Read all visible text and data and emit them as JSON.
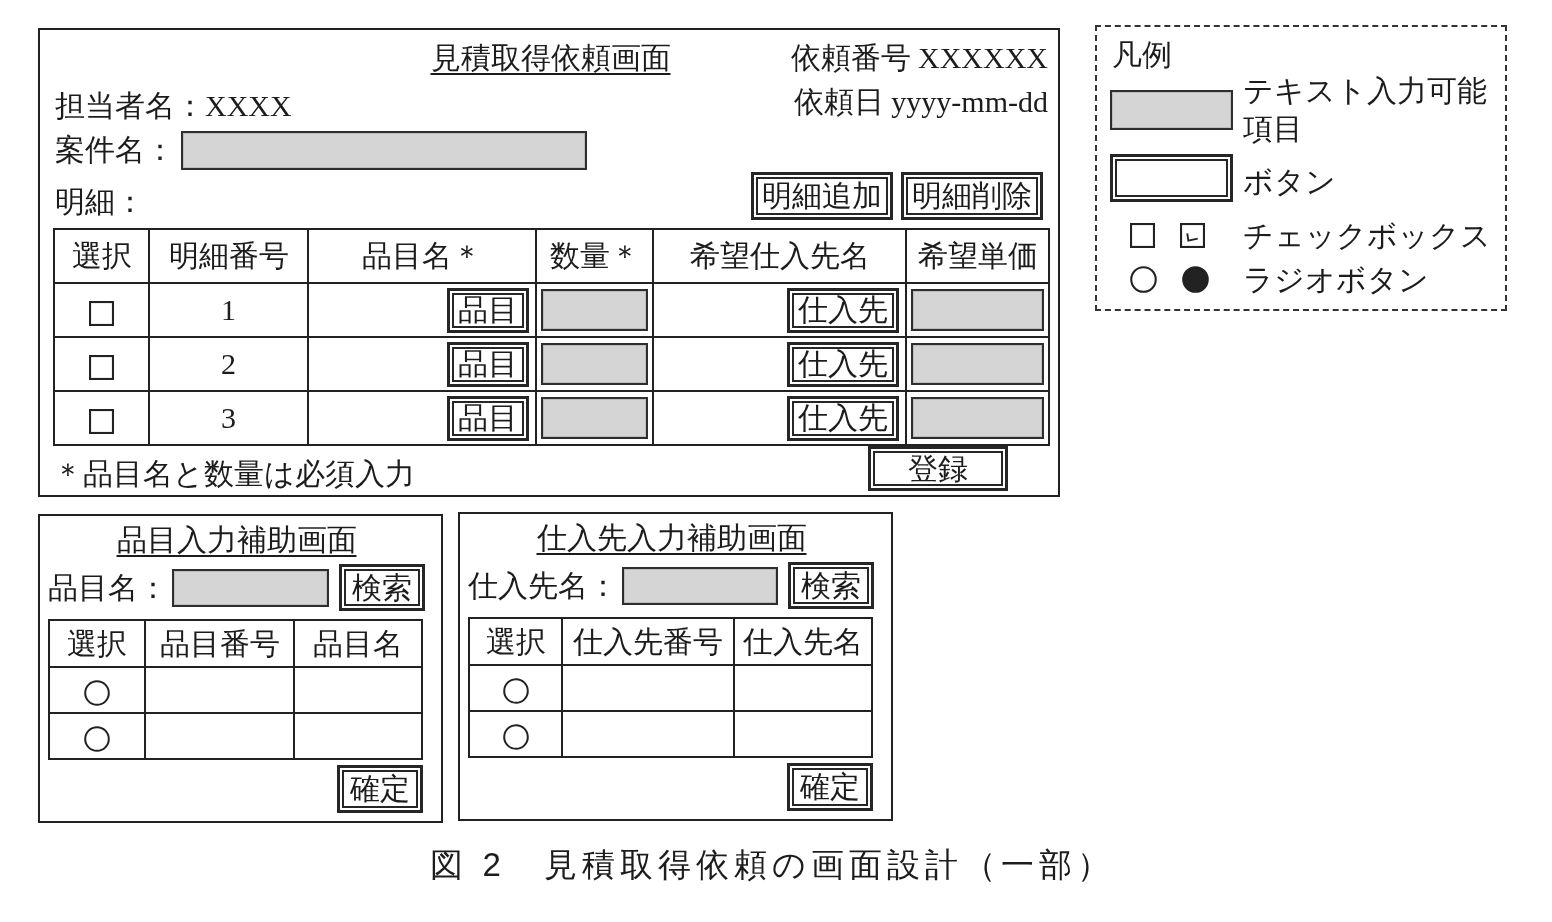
{
  "main_screen": {
    "title": "見積取得依頼画面",
    "request_number": "依頼番号 XXXXXX",
    "request_date": "依頼日 yyyy-mm-dd",
    "person_in_charge": "担当者名：XXXX",
    "case_name_label": "案件名：",
    "details_label": "明細：",
    "buttons": [
      "明細追加",
      "明細削除"
    ],
    "table": {
      "columns": [
        "選択",
        "明細番号",
        "品目名＊",
        "数量＊",
        "希望仕入先名",
        "希望単価"
      ],
      "rows": [
        {
          "cells": [
            {
              "kind": "checkbox",
              "checked": false
            },
            {
              "kind": "text",
              "text": "1"
            },
            {
              "kind": "button",
              "label": "品目"
            },
            {
              "kind": "input"
            },
            {
              "kind": "button",
              "label": "仕入先"
            },
            {
              "kind": "input"
            }
          ]
        },
        {
          "cells": [
            {
              "kind": "checkbox",
              "checked": false
            },
            {
              "kind": "text",
              "text": "2"
            },
            {
              "kind": "button",
              "label": "品目"
            },
            {
              "kind": "input"
            },
            {
              "kind": "button",
              "label": "仕入先"
            },
            {
              "kind": "input"
            }
          ]
        },
        {
          "cells": [
            {
              "kind": "checkbox",
              "checked": false
            },
            {
              "kind": "text",
              "text": "3"
            },
            {
              "kind": "button",
              "label": "品目"
            },
            {
              "kind": "input"
            },
            {
              "kind": "button",
              "label": "仕入先"
            },
            {
              "kind": "input"
            }
          ]
        }
      ]
    },
    "note": "＊品目名と数量は必須入力",
    "register_button": "登録"
  },
  "legend": {
    "title": "凡例",
    "entries": [
      {
        "kind": "text_input",
        "label": "テキスト入力可能項目"
      },
      {
        "kind": "button",
        "label": "ボタン"
      },
      {
        "kind": "checkbox",
        "label": "チェックボックス",
        "samples": [
          {
            "checked": false
          },
          {
            "checked": true
          }
        ]
      },
      {
        "kind": "radio",
        "label": "ラジオボタン",
        "samples": [
          {
            "selected": false
          },
          {
            "selected": true
          }
        ]
      }
    ]
  },
  "item_helper": {
    "title": "品目入力補助画面",
    "search_label": "品目名：",
    "search_button": "検索",
    "table": {
      "columns": [
        "選択",
        "品目番号",
        "品目名"
      ],
      "rows": [
        {
          "selected": false
        },
        {
          "selected": false
        }
      ]
    },
    "confirm_button": "確定"
  },
  "supplier_helper": {
    "title": "仕入先入力補助画面",
    "search_label": "仕入先名：",
    "search_button": "検索",
    "table": {
      "columns": [
        "選択",
        "仕入先番号",
        "仕入先名"
      ],
      "rows": [
        {
          "selected": false
        },
        {
          "selected": false
        }
      ]
    },
    "confirm_button": "確定"
  },
  "caption": "図 2　見積取得依頼の画面設計（一部）"
}
